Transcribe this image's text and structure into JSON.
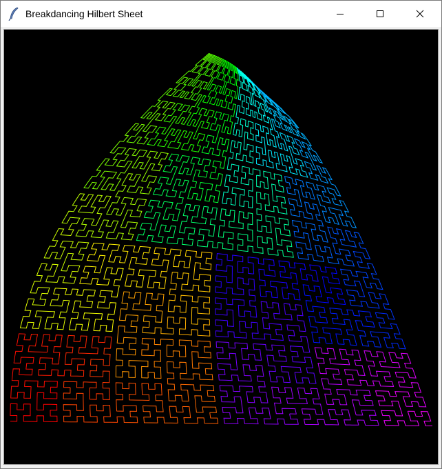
{
  "window": {
    "title": "Breakdancing Hilbert Sheet",
    "icon": "feather-icon"
  },
  "controls": {
    "minimize_icon": "minimize-icon",
    "maximize_icon": "maximize-icon",
    "close_icon": "close-icon"
  },
  "canvas": {
    "background": "#000000",
    "hilbert_order": 6,
    "hue_range": [
      0,
      360
    ]
  }
}
